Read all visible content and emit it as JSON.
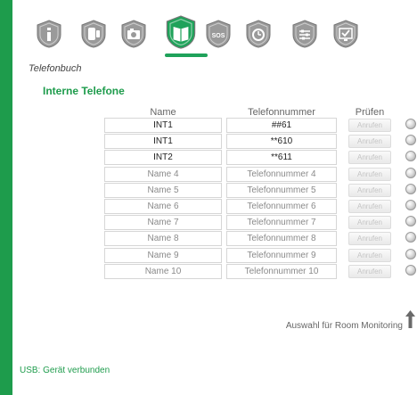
{
  "colors": {
    "accent": "#1e9c4c",
    "sidebar": "#1e9c4c",
    "icon_gray": "#9a9a9a",
    "icon_active": "#1fa25a"
  },
  "icons": [
    {
      "name": "info-icon",
      "glyph": "i",
      "active": false
    },
    {
      "name": "phone-icon",
      "glyph": "phone",
      "active": false
    },
    {
      "name": "camera-icon",
      "glyph": "cam",
      "active": false
    },
    {
      "name": "phonebook-icon",
      "glyph": "book",
      "active": true
    },
    {
      "name": "sos-icon",
      "glyph": "SOS",
      "active": false
    },
    {
      "name": "alarm-clock-icon",
      "glyph": "clock",
      "active": false
    },
    {
      "name": "settings-sliders-icon",
      "glyph": "sliders",
      "active": false
    },
    {
      "name": "monitor-check-icon",
      "glyph": "check",
      "active": false
    }
  ],
  "page": {
    "section_title": "Telefonbuch",
    "subsection_title": "Interne Telefone"
  },
  "table": {
    "headers": {
      "name": "Name",
      "number": "Telefonnummer",
      "check": "Prüfen"
    },
    "rows": [
      {
        "name": "INT1",
        "number": "##61",
        "filled": true,
        "button": "Anrufen"
      },
      {
        "name": "INT1",
        "number": "**610",
        "filled": true,
        "button": "Anrufen"
      },
      {
        "name": "INT2",
        "number": "**611",
        "filled": true,
        "button": "Anrufen"
      },
      {
        "name": "Name 4",
        "number": "Telefonnummer 4",
        "filled": false,
        "button": "Anrufen"
      },
      {
        "name": "Name 5",
        "number": "Telefonnummer 5",
        "filled": false,
        "button": "Anrufen"
      },
      {
        "name": "Name 6",
        "number": "Telefonnummer 6",
        "filled": false,
        "button": "Anrufen"
      },
      {
        "name": "Name 7",
        "number": "Telefonnummer 7",
        "filled": false,
        "button": "Anrufen"
      },
      {
        "name": "Name 8",
        "number": "Telefonnummer 8",
        "filled": false,
        "button": "Anrufen"
      },
      {
        "name": "Name 9",
        "number": "Telefonnummer 9",
        "filled": false,
        "button": "Anrufen"
      },
      {
        "name": "Name 10",
        "number": "Telefonnummer 10",
        "filled": false,
        "button": "Anrufen"
      }
    ]
  },
  "room_monitoring": {
    "label": "Auswahl für Room Monitoring",
    "icon": "up-arrow-icon"
  },
  "status": {
    "text": "USB: Gerät verbunden"
  }
}
